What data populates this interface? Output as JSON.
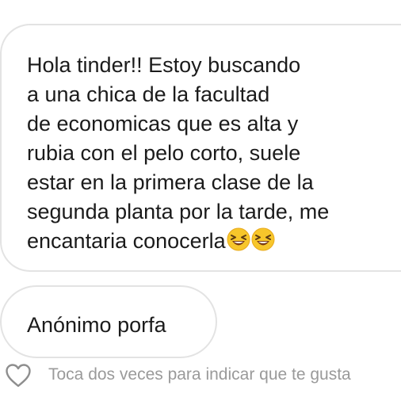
{
  "messages": [
    {
      "text": "Hola tinder!! Estoy buscando\na una chica de la facultad\nde economicas que es alta y\nrubia con el pelo corto, suele\nestar en la primera clase de la\nsegunda planta por la tarde, me\nencantaria conocerla",
      "emojis": [
        "grinning-squinting-face-emoji",
        "grinning-squinting-face-emoji"
      ]
    },
    {
      "text": "Anónimo porfa"
    }
  ],
  "like_hint": "Toca dos veces para indicar que te gusta",
  "icons": {
    "like": "heart-outline-icon"
  },
  "colors": {
    "bubble_border": "#e3e3e3",
    "text": "#1b1b1b",
    "hint_text": "#9a9a9a",
    "emoji_face": "#f7c62b"
  }
}
